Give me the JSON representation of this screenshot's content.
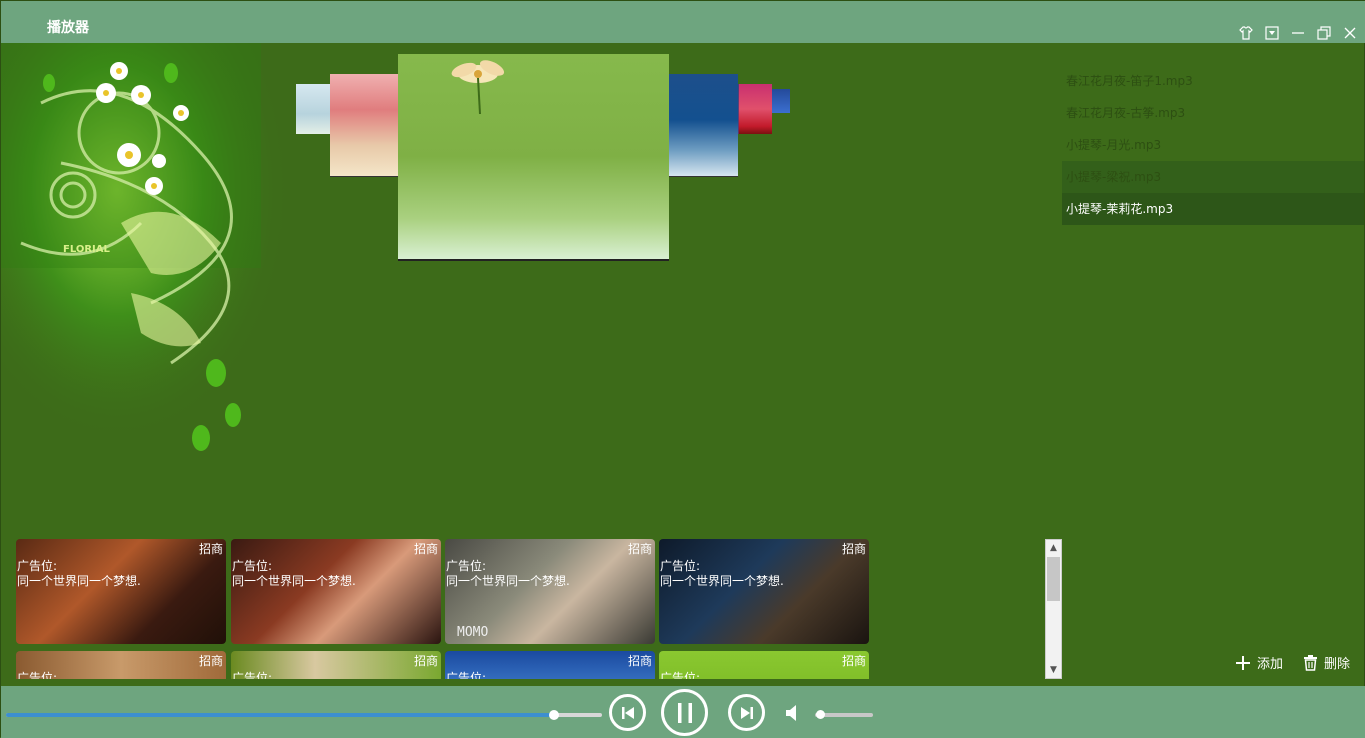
{
  "window": {
    "title": "播放器"
  },
  "titlebar_icons": [
    "skin-icon",
    "dropdown-icon",
    "minimize-icon",
    "restore-icon",
    "close-icon"
  ],
  "playlist": {
    "items": [
      {
        "label": "春江花月夜-笛子1.mp3",
        "state": "normal"
      },
      {
        "label": "春江花月夜-古筝.mp3",
        "state": "normal"
      },
      {
        "label": "小提琴-月光.mp3",
        "state": "normal"
      },
      {
        "label": "小提琴-梁祝.mp3",
        "state": "hover"
      },
      {
        "label": "小提琴-茉莉花.mp3",
        "state": "selected"
      }
    ],
    "add_label": "添加",
    "delete_label": "删除"
  },
  "ads": {
    "tag": "招商",
    "line1": "广告位:",
    "line2": "同一个世界同一个梦想.",
    "row1_momo": "MOMO"
  },
  "player": {
    "progress": 0.92,
    "volume": 0.08
  },
  "art": {
    "brand": "FLORIAL"
  }
}
